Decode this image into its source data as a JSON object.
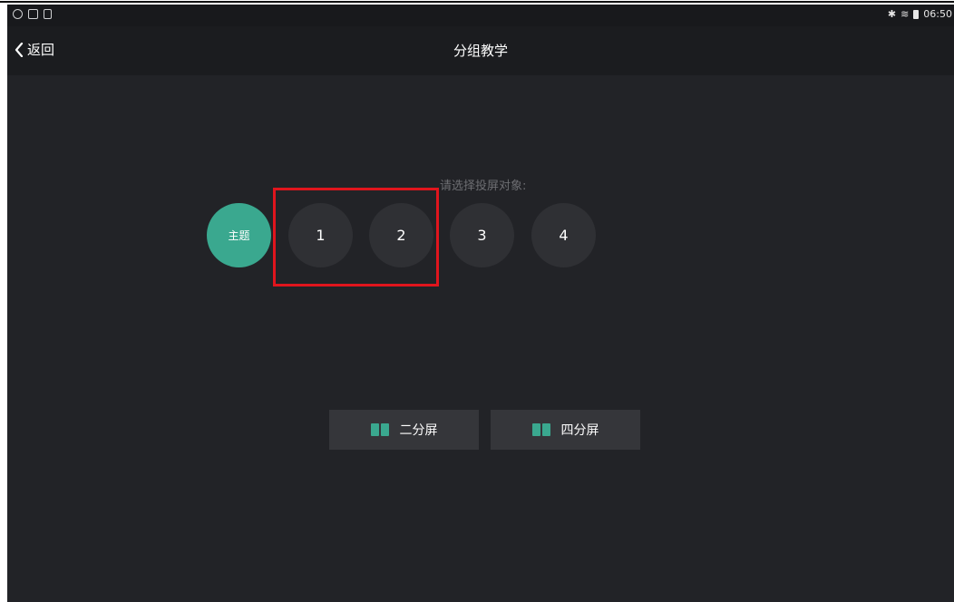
{
  "status_bar": {
    "time": "06:50",
    "left_icons": [
      "wechat-icon",
      "image-icon",
      "phone-icon"
    ],
    "right_icons": [
      "bluetooth-icon",
      "wifi-icon",
      "battery-icon"
    ]
  },
  "nav": {
    "back_label": "返回",
    "title": "分组教学"
  },
  "prompt": "请选择投屏对象:",
  "targets": [
    {
      "label": "主题",
      "selected": true
    },
    {
      "label": "1",
      "selected": false
    },
    {
      "label": "2",
      "selected": false
    },
    {
      "label": "3",
      "selected": false
    },
    {
      "label": "4",
      "selected": false
    }
  ],
  "split_buttons": [
    {
      "label": "二分屏",
      "icon": "split-screen-icon"
    },
    {
      "label": "四分屏",
      "icon": "split-screen-icon"
    }
  ],
  "colors": {
    "background": "#222327",
    "accent": "#3aa88f",
    "circle": "#2f3034",
    "button": "#35363a",
    "highlight": "#e0151d"
  }
}
